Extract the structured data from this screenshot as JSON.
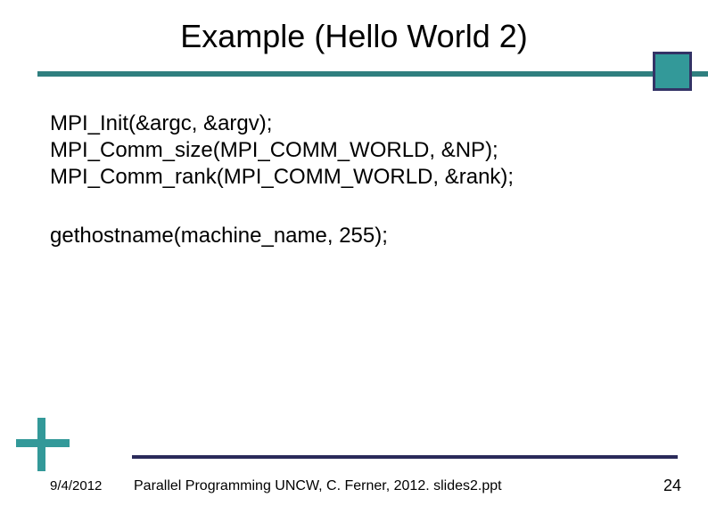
{
  "title": "Example (Hello World 2)",
  "code": {
    "block1": {
      "l1": "MPI_Init(&argc, &argv);",
      "l2": "MPI_Comm_size(MPI_COMM_WORLD, &NP);",
      "l3": "MPI_Comm_rank(MPI_COMM_WORLD, &rank);"
    },
    "block2": {
      "l1": "gethostname(machine_name, 255);"
    }
  },
  "footer": {
    "date": "9/4/2012",
    "text": "Parallel Programming  UNCW, C. Ferner, 2012. slides2.ppt",
    "page": "24"
  }
}
